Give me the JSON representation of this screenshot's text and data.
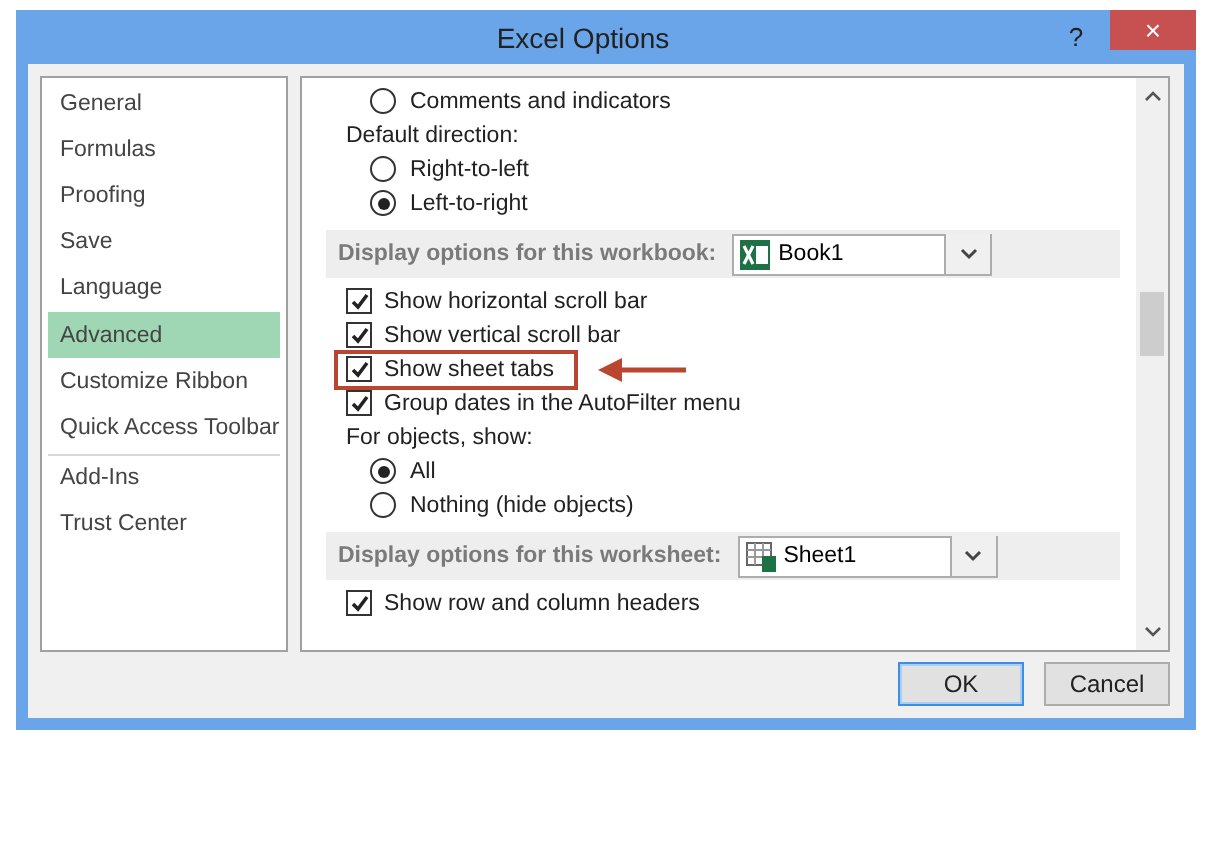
{
  "window": {
    "title": "Excel Options",
    "help": "?",
    "close": "×"
  },
  "sidebar": {
    "groups": [
      {
        "items": [
          {
            "label": "General",
            "selected": false
          },
          {
            "label": "Formulas",
            "selected": false
          },
          {
            "label": "Proofing",
            "selected": false
          },
          {
            "label": "Save",
            "selected": false
          },
          {
            "label": "Language",
            "selected": false
          },
          {
            "label": "Advanced",
            "selected": true
          },
          {
            "label": "Customize Ribbon",
            "selected": false
          },
          {
            "label": "Quick Access Toolbar",
            "selected": false
          }
        ]
      },
      {
        "items": [
          {
            "label": "Add-Ins",
            "selected": false
          },
          {
            "label": "Trust Center",
            "selected": false
          }
        ]
      }
    ]
  },
  "content": {
    "rows": [
      {
        "kind": "radio",
        "label": "Comments and indicators",
        "selected": false
      },
      {
        "kind": "label",
        "label": "Default direction:"
      },
      {
        "kind": "radio",
        "label": "Right-to-left",
        "selected": false
      },
      {
        "kind": "radio",
        "label": "Left-to-right",
        "selected": true
      },
      {
        "kind": "workbook-section",
        "label": "Display options for this workbook:",
        "value": "Book1"
      },
      {
        "kind": "check",
        "label": "Show horizontal scroll bar",
        "checked": true,
        "highlighted": false
      },
      {
        "kind": "check",
        "label": "Show vertical scroll bar",
        "checked": true,
        "highlighted": false
      },
      {
        "kind": "check",
        "label": "Show sheet tabs",
        "checked": true,
        "highlighted": true
      },
      {
        "kind": "check",
        "label": "Group dates in the AutoFilter menu",
        "checked": true,
        "highlighted": false
      },
      {
        "kind": "label",
        "label": "For objects, show:"
      },
      {
        "kind": "radio",
        "label": "All",
        "selected": true
      },
      {
        "kind": "radio",
        "label": "Nothing (hide objects)",
        "selected": false
      },
      {
        "kind": "worksheet-section",
        "label": "Display options for this worksheet:",
        "value": "Sheet1"
      },
      {
        "kind": "check",
        "label": "Show row and column headers",
        "checked": true,
        "highlighted": false
      }
    ]
  },
  "buttons": [
    {
      "label": "OK",
      "default": true
    },
    {
      "label": "Cancel",
      "default": false
    }
  ]
}
